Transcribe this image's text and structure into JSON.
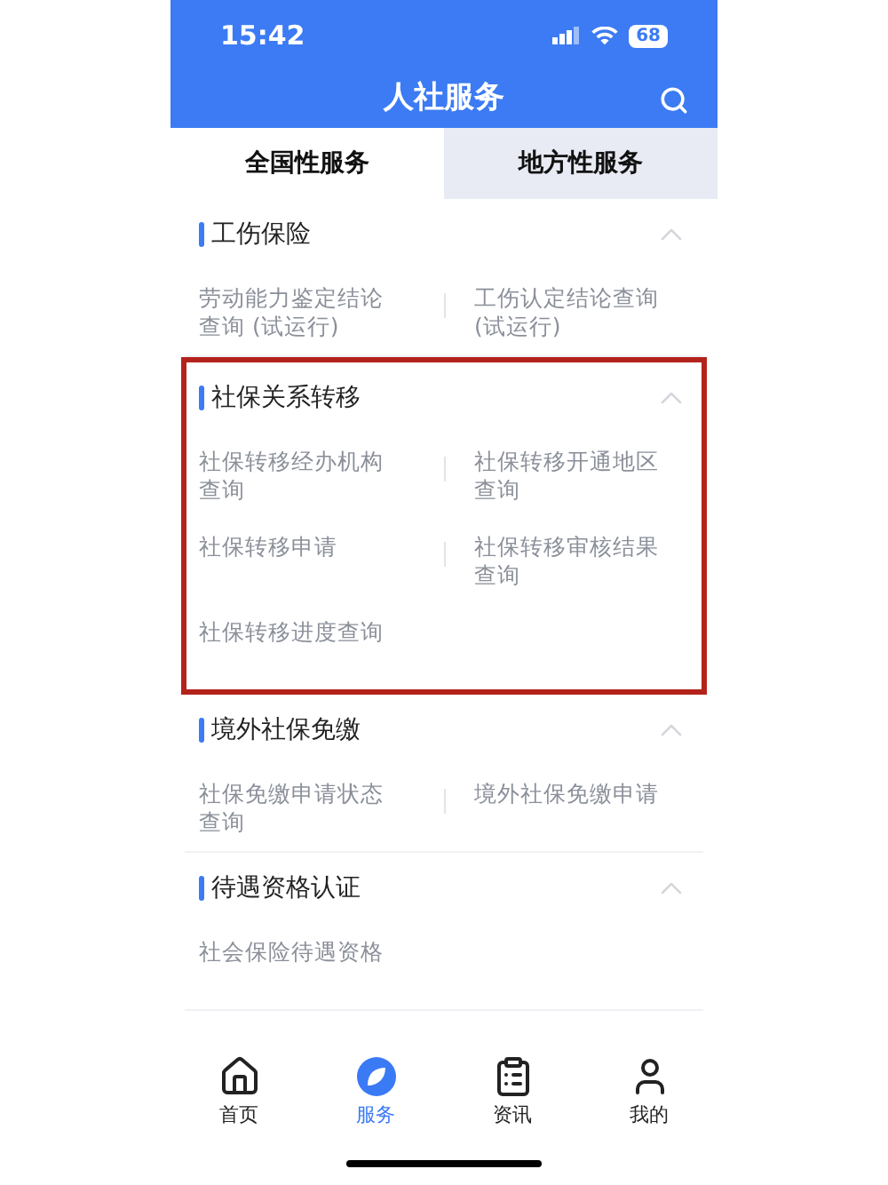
{
  "status_bar": {
    "time": "15:42",
    "battery": "68"
  },
  "header": {
    "title": "人社服务"
  },
  "tabs": [
    {
      "label": "全国性服务",
      "selected": true
    },
    {
      "label": "地方性服务",
      "selected": false
    }
  ],
  "sections": [
    {
      "title": "工伤保险",
      "expanded": true,
      "highlighted": false,
      "items": [
        "劳动能力鉴定结论查询 (试运行)",
        "工伤认定结论查询 (试运行)"
      ]
    },
    {
      "title": "社保关系转移",
      "expanded": true,
      "highlighted": true,
      "items": [
        "社保转移经办机构查询",
        "社保转移开通地区查询",
        "社保转移申请",
        "社保转移审核结果查询",
        "社保转移进度查询"
      ]
    },
    {
      "title": "境外社保免缴",
      "expanded": true,
      "highlighted": false,
      "items": [
        "社保免缴申请状态查询",
        "境外社保免缴申请"
      ]
    },
    {
      "title": "待遇资格认证",
      "expanded": true,
      "highlighted": false,
      "items": [
        "社会保险待遇资格"
      ]
    }
  ],
  "nav": [
    {
      "label": "首页",
      "kind": "home",
      "selected": false
    },
    {
      "label": "服务",
      "kind": "service",
      "selected": true
    },
    {
      "label": "资讯",
      "kind": "news",
      "selected": false
    },
    {
      "label": "我的",
      "kind": "profile",
      "selected": false
    }
  ]
}
